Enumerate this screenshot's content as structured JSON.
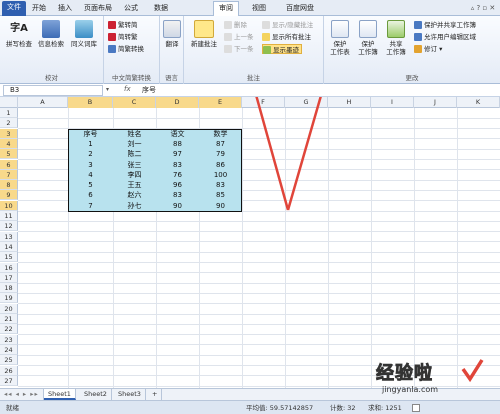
{
  "tabs": [
    "文件",
    "开始",
    "插入",
    "页面布局",
    "公式",
    "数据",
    "审阅",
    "视图",
    "百度网盘"
  ],
  "ribbon": {
    "proofing": {
      "buttons": [
        "拼写检查",
        "信息检索",
        "同义词库"
      ],
      "label": "校对",
      "icon_text": "字A"
    },
    "chinese": {
      "buttons": [
        "繁转简",
        "简转繁",
        "简繁转换"
      ],
      "label": "中文简繁转换"
    },
    "language": {
      "button": "翻译",
      "label": "语言"
    },
    "comments": {
      "new": "新建批注",
      "delete": "删除",
      "prev": "上一条",
      "next": "下一条",
      "show_hide": "显示/隐藏批注",
      "show_all": "显示所有批注",
      "show_ink": "显示墨迹",
      "label": "批注"
    },
    "changes": {
      "protect_sheet": [
        "保护",
        "工作表"
      ],
      "protect_workbook": [
        "保护",
        "工作簿"
      ],
      "share_workbook": [
        "共享",
        "工作簿"
      ],
      "protect_share": "保护并共享工作簿",
      "allow_edit": "允许用户编辑区域",
      "track": "修订",
      "label": "更改"
    }
  },
  "formula": {
    "namebox": "B3",
    "fx": "fx",
    "value": "序号"
  },
  "columns": [
    "A",
    "B",
    "C",
    "D",
    "E",
    "F",
    "G",
    "H",
    "I",
    "J",
    "K"
  ],
  "rows": [
    "1",
    "2",
    "3",
    "4",
    "5",
    "6",
    "7",
    "8",
    "9",
    "10",
    "11",
    "12",
    "13",
    "14",
    "15",
    "16",
    "17",
    "18",
    "19",
    "20",
    "21",
    "22",
    "23",
    "24",
    "25",
    "26",
    "27"
  ],
  "table": {
    "headers": [
      "序号",
      "姓名",
      "语文",
      "数学"
    ],
    "rows": [
      [
        "1",
        "刘一",
        "88",
        "87"
      ],
      [
        "2",
        "陈二",
        "97",
        "79"
      ],
      [
        "3",
        "张三",
        "83",
        "86"
      ],
      [
        "4",
        "李四",
        "76",
        "100"
      ],
      [
        "5",
        "王五",
        "96",
        "83"
      ],
      [
        "6",
        "赵六",
        "83",
        "85"
      ],
      [
        "7",
        "孙七",
        "90",
        "90"
      ]
    ]
  },
  "sheets": [
    "Sheet1",
    "Sheet2",
    "Sheet3"
  ],
  "status": {
    "mode": "就绪",
    "average": "平均值: 59.57142857",
    "count": "计数: 32",
    "sum": "求和: 1251"
  },
  "watermark": {
    "text": "经验啦",
    "url": "jingyanla.com"
  },
  "colors": {
    "selection": "#b8e2ee",
    "arrow": "#e0453a",
    "file_tab": "#2f5fb0"
  }
}
